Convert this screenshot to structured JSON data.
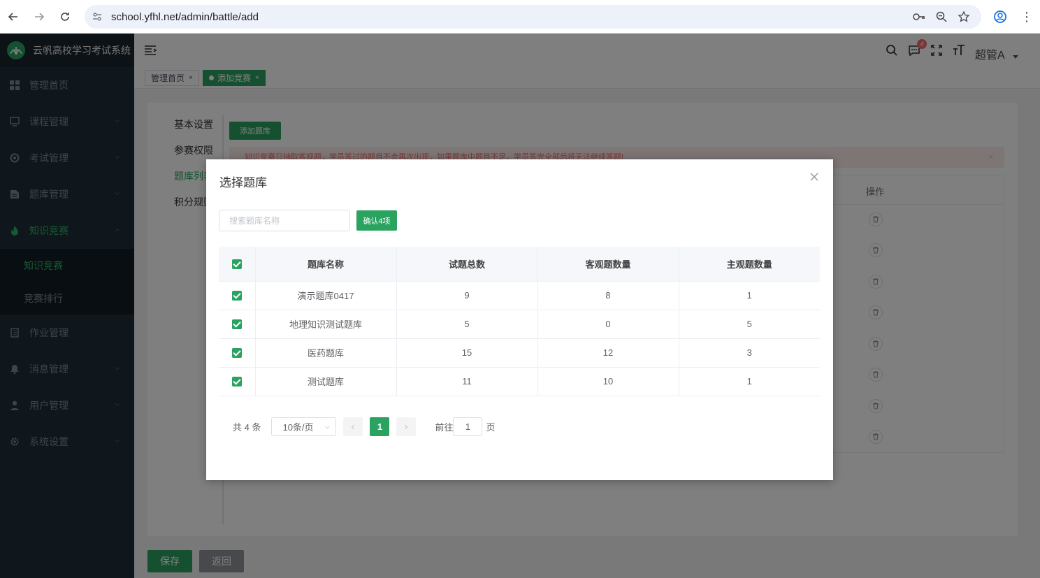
{
  "browser": {
    "url": "school.yfhl.net/admin/battle/add"
  },
  "sidebar": {
    "brand": "云帆高校学习考试系统",
    "items": [
      {
        "label": "管理首页"
      },
      {
        "label": "课程管理"
      },
      {
        "label": "考试管理"
      },
      {
        "label": "题库管理"
      },
      {
        "label": "知识竞赛"
      },
      {
        "label": "作业管理"
      },
      {
        "label": "消息管理"
      },
      {
        "label": "用户管理"
      },
      {
        "label": "系统设置"
      }
    ],
    "sub_items": [
      {
        "label": "知识竞赛"
      },
      {
        "label": "竞赛排行"
      }
    ]
  },
  "header": {
    "notification_count": "4",
    "user_name": "超管A"
  },
  "tags": [
    {
      "label": "管理首页"
    },
    {
      "label": "添加竞赛"
    }
  ],
  "form": {
    "tabs": [
      "基本设置",
      "参赛权限",
      "题库列表",
      "积分规则"
    ],
    "add_library_label": "添加题库",
    "warning_text": "知识竞赛只抽取客观题，学员答过的题目不会再次出现，如果题库中题目不足，学员答完全部后将无法继续答题!",
    "operation_header": "操作",
    "save_label": "保存",
    "back_label": "返回"
  },
  "dialog": {
    "title": "选择题库",
    "search_placeholder": "搜索题库名称",
    "confirm_label": "确认4项",
    "columns": [
      "题库名称",
      "试题总数",
      "客观题数量",
      "主观题数量"
    ],
    "rows": [
      {
        "name": "演示题库0417",
        "total": "9",
        "objective": "8",
        "subjective": "1"
      },
      {
        "name": "地理知识测试题库",
        "total": "5",
        "objective": "0",
        "subjective": "5"
      },
      {
        "name": "医药题库",
        "total": "15",
        "objective": "12",
        "subjective": "3"
      },
      {
        "name": "测试题库",
        "total": "11",
        "objective": "10",
        "subjective": "1"
      }
    ],
    "pagination": {
      "total_text": "共 4 条",
      "page_size": "10条/页",
      "current_page": "1",
      "goto_label": "前往",
      "goto_value": "1",
      "page_suffix": "页"
    }
  },
  "colors": {
    "accent": "#2aa260",
    "sidebar_bg": "#1e2c38",
    "warning_text": "#f56c6c"
  }
}
